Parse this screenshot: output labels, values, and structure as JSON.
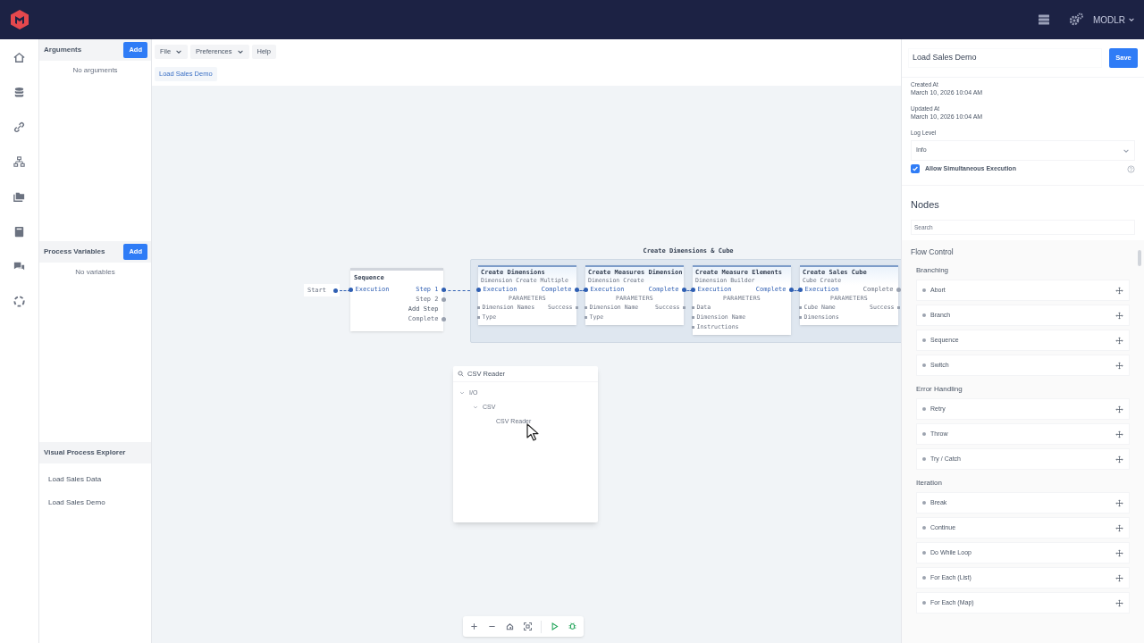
{
  "top_bar": {
    "user_menu": "MODLR"
  },
  "left_panel": {
    "arguments": {
      "title": "Arguments",
      "add": "Add",
      "empty": "No arguments"
    },
    "variables": {
      "title": "Process Variables",
      "add": "Add",
      "empty": "No variables"
    },
    "explorer": {
      "title": "Visual Process Explorer",
      "items": [
        "Load Sales Data",
        "Load Sales Demo"
      ]
    }
  },
  "menu": [
    {
      "label": "File",
      "dropdown": true
    },
    {
      "label": "Preferences",
      "dropdown": true
    },
    {
      "label": "Help",
      "dropdown": false
    }
  ],
  "tabs": [
    {
      "label": "Load Sales Demo",
      "selected": true
    }
  ],
  "canvas": {
    "start": {
      "label": "Start",
      "connected": true
    },
    "sequence": {
      "title": "Sequence",
      "input": "Execution",
      "outputs": [
        {
          "label": "Step 1",
          "kind": "port",
          "connected": true
        },
        {
          "label": "Step 2",
          "kind": "port",
          "connected": false
        },
        {
          "label": "Add Step",
          "kind": "action",
          "connected": false
        },
        {
          "label": "Complete",
          "kind": "port",
          "connected": false
        }
      ]
    },
    "group": {
      "title": "Create Dimensions & Cube",
      "nodes": [
        {
          "title": "Create Dimensions",
          "subtitle": "Dimension Create Multiple",
          "input": "Execution",
          "output": "Complete",
          "connected": true,
          "section": "PARAMETERS",
          "params": [
            "Dimension Names",
            "Type"
          ],
          "results": [
            "Success"
          ]
        },
        {
          "title": "Create Measures Dimension",
          "subtitle": "Dimension Create",
          "input": "Execution",
          "output": "Complete",
          "connected": true,
          "section": "PARAMETERS",
          "params": [
            "Dimension Name",
            "Type"
          ],
          "results": [
            "Success"
          ]
        },
        {
          "title": "Create Measure Elements",
          "subtitle": "Dimension Builder",
          "input": "Execution",
          "output": "Complete",
          "connected": true,
          "section": "PARAMETERS",
          "params": [
            "Data",
            "Dimension Name",
            "Instructions"
          ]
        },
        {
          "title": "Create Sales Cube",
          "subtitle": "Cube Create",
          "input": "Execution",
          "output": "Complete",
          "connected": false,
          "section": "PARAMETERS",
          "params": [
            "Cube Name",
            "Dimensions"
          ],
          "results": [
            "Success"
          ]
        }
      ]
    },
    "node_search": {
      "query": "CSV Reader",
      "tree": [
        {
          "label": "I/O",
          "expanded": true,
          "children": [
            {
              "label": "CSV",
              "expanded": true,
              "children": [
                {
                  "label": "CSV Reader"
                }
              ]
            }
          ]
        }
      ]
    }
  },
  "properties": {
    "name": "Load Sales Demo",
    "save": "Save",
    "created_label": "Created At",
    "created": "March 10, 2026 10:04 AM",
    "updated_label": "Updated At",
    "updated": "March 10, 2026 10:04 AM",
    "log_level_label": "Log Level",
    "log_level": "Info",
    "simultaneous": {
      "label": "Allow Simultaneous Execution",
      "checked": true
    }
  },
  "nodes_panel": {
    "title": "Nodes",
    "search_placeholder": "Search",
    "categories": [
      {
        "title": "Flow Control",
        "groups": [
          {
            "title": "Branching",
            "items": [
              "Abort",
              "Branch",
              "Sequence",
              "Switch"
            ]
          },
          {
            "title": "Error Handling",
            "items": [
              "Retry",
              "Throw",
              "Try / Catch"
            ]
          },
          {
            "title": "Iteration",
            "items": [
              "Break",
              "Continue",
              "Do While Loop",
              "For Each (List)",
              "For Each (Map)"
            ]
          }
        ]
      }
    ]
  }
}
